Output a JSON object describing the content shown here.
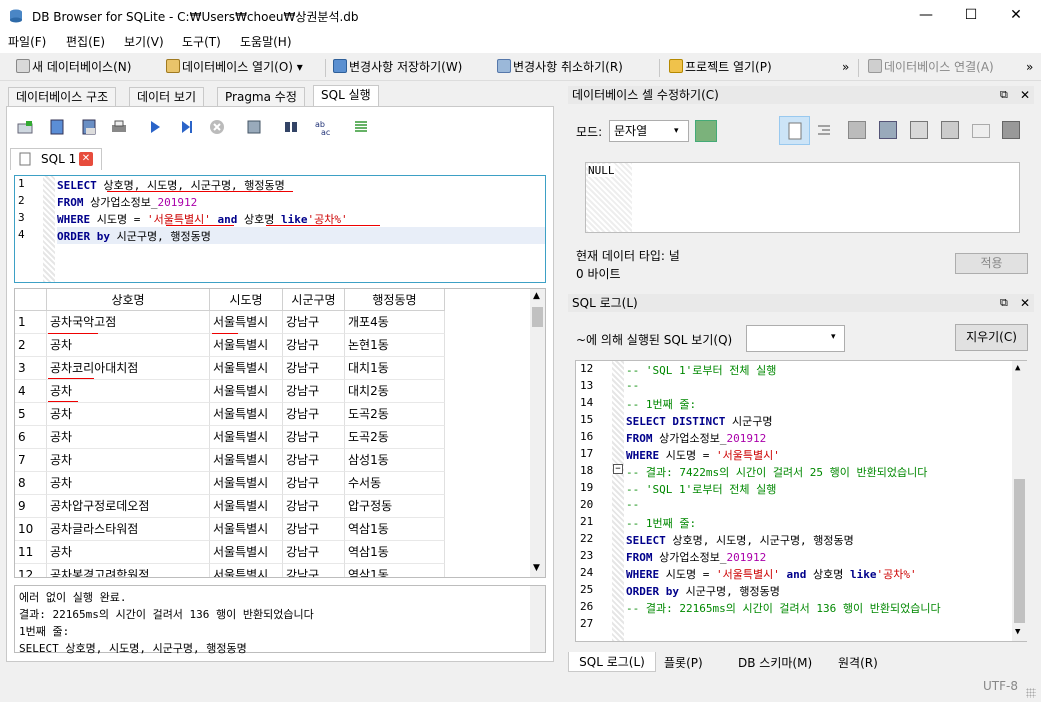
{
  "window": {
    "title": "DB Browser for SQLite - C:₩Users₩choeu₩상권분석.db",
    "minimize": "—",
    "maximize": "☐",
    "close": "✕"
  },
  "menu": [
    "파일(F)",
    "편집(E)",
    "보기(V)",
    "도구(T)",
    "도움말(H)"
  ],
  "toolbar": {
    "new_db": "새 데이터베이스(N)",
    "open_db": "데이터베이스 열기(O)",
    "write_changes": "변경사항 저장하기(W)",
    "revert_changes": "변경사항 취소하기(R)",
    "open_project": "프로젝트 열기(P)",
    "attach_db": "데이터베이스 연결(A)",
    "overflow": "»"
  },
  "tabs": [
    "데이터베이스 구조",
    "데이터 보기",
    "Pragma 수정",
    "SQL 실행"
  ],
  "sql_tab": {
    "label": "SQL 1"
  },
  "editor": {
    "lines": [
      {
        "n": "1",
        "parts": [
          [
            "kw",
            "SELECT"
          ],
          [
            "",
            "상호명, 시도명, 시군구명, 행정동명"
          ]
        ]
      },
      {
        "n": "2",
        "parts": [
          [
            "kw",
            "FROM"
          ],
          [
            "",
            "상가업소정보_"
          ],
          [
            "num",
            "201912"
          ]
        ]
      },
      {
        "n": "3",
        "parts": [
          [
            "kw",
            "WHERE"
          ],
          [
            "",
            "시도명 = "
          ],
          [
            "str",
            "'서울특별시'"
          ],
          [
            "kw",
            " and"
          ],
          [
            "",
            "상호명 "
          ],
          [
            "kw",
            "like"
          ],
          [
            "str",
            "'공차%'"
          ]
        ]
      },
      {
        "n": "4",
        "parts": [
          [
            "kw",
            "ORDER by"
          ],
          [
            "",
            "시군구명, 행정동명"
          ]
        ]
      }
    ]
  },
  "results": {
    "columns": [
      "상호명",
      "시도명",
      "시군구명",
      "행정동명"
    ],
    "rows": [
      [
        "1",
        "공차국악고점",
        "서울특별시",
        "강남구",
        "개포4동"
      ],
      [
        "2",
        "공차",
        "서울특별시",
        "강남구",
        "논현1동"
      ],
      [
        "3",
        "공차코리아대치점",
        "서울특별시",
        "강남구",
        "대치1동"
      ],
      [
        "4",
        "공차",
        "서울특별시",
        "강남구",
        "대치2동"
      ],
      [
        "5",
        "공차",
        "서울특별시",
        "강남구",
        "도곡2동"
      ],
      [
        "6",
        "공차",
        "서울특별시",
        "강남구",
        "도곡2동"
      ],
      [
        "7",
        "공차",
        "서울특별시",
        "강남구",
        "삼성1동"
      ],
      [
        "8",
        "공차",
        "서울특별시",
        "강남구",
        "수서동"
      ],
      [
        "9",
        "공차압구정로데오점",
        "서울특별시",
        "강남구",
        "압구정동"
      ],
      [
        "10",
        "공차글라스타워점",
        "서울특별시",
        "강남구",
        "역삼1동"
      ],
      [
        "11",
        "공차",
        "서울특별시",
        "강남구",
        "역삼1동"
      ],
      [
        "12",
        "공차봉경고려학원점",
        "서울특별시",
        "강남구",
        "역삼1동"
      ]
    ]
  },
  "messages": [
    "에러 없이 실행 완료.",
    "결과: 22165ms의 시간이 걸려서 136 행이 반환되었습니다",
    "1번째 줄:",
    "SELECT 상호명, 시도명, 시군구명, 행정동명"
  ],
  "cell_editor": {
    "header": "데이터베이스 셀 수정하기(C)",
    "mode_label": "모드:",
    "mode_value": "문자열",
    "value": "NULL",
    "type_label": "현재 데이터 타입: 널",
    "size_label": "0 바이트",
    "apply": "적용"
  },
  "sql_log": {
    "header": "SQL 로그(L)",
    "submitted_label": "~에 의해 실행된 SQL 보기(Q)",
    "clear": "지우기(C)",
    "lines": [
      {
        "n": "12",
        "parts": [
          [
            "cmt",
            "-- 'SQL 1'로부터 전체 실행"
          ]
        ]
      },
      {
        "n": "13",
        "parts": [
          [
            "cmt",
            "--"
          ]
        ]
      },
      {
        "n": "14",
        "parts": [
          [
            "cmt",
            "-- 1번째 줄:"
          ]
        ]
      },
      {
        "n": "15",
        "parts": [
          [
            "kw",
            "SELECT DISTINCT"
          ],
          [
            "",
            "시군구명"
          ]
        ]
      },
      {
        "n": "16",
        "parts": [
          [
            "kw",
            "FROM"
          ],
          [
            "",
            "상가업소정보_"
          ],
          [
            "num",
            "201912"
          ]
        ]
      },
      {
        "n": "17",
        "parts": [
          [
            "kw",
            "WHERE"
          ],
          [
            "",
            "시도명 = "
          ],
          [
            "str",
            "'서울특별시'"
          ]
        ]
      },
      {
        "n": "18",
        "parts": [
          [
            "cmt",
            "-- 결과: 7422ms의 시간이 걸려서 25 행이 반환되었습니다"
          ]
        ]
      },
      {
        "n": "19",
        "parts": [
          [
            "cmt",
            "-- 'SQL 1'로부터 전체 실행"
          ]
        ]
      },
      {
        "n": "20",
        "parts": [
          [
            "cmt",
            "--"
          ]
        ]
      },
      {
        "n": "21",
        "parts": [
          [
            "cmt",
            "-- 1번째 줄:"
          ]
        ]
      },
      {
        "n": "22",
        "parts": [
          [
            "kw",
            "SELECT"
          ],
          [
            "",
            "상호명, 시도명, 시군구명, 행정동명"
          ]
        ]
      },
      {
        "n": "23",
        "parts": [
          [
            "kw",
            "FROM"
          ],
          [
            "",
            "상가업소정보_"
          ],
          [
            "num",
            "201912"
          ]
        ]
      },
      {
        "n": "24",
        "parts": [
          [
            "kw",
            "WHERE"
          ],
          [
            "",
            "시도명 = "
          ],
          [
            "str",
            "'서울특별시'"
          ],
          [
            "kw",
            " and"
          ],
          [
            "",
            "상호명 "
          ],
          [
            "kw",
            "like"
          ],
          [
            "str",
            "'공차%'"
          ]
        ]
      },
      {
        "n": "25",
        "parts": [
          [
            "kw",
            "ORDER by"
          ],
          [
            "",
            "시군구명, 행정동명"
          ]
        ]
      },
      {
        "n": "26",
        "parts": [
          [
            "cmt",
            "-- 결과: 22165ms의 시간이 걸려서 136 행이 반환되었습니다"
          ]
        ]
      },
      {
        "n": "27",
        "parts": []
      }
    ]
  },
  "bottom_tabs": [
    "SQL 로그(L)",
    "플롯(P)",
    "DB 스키마(M)",
    "원격(R)"
  ],
  "status": {
    "encoding": "UTF-8"
  }
}
